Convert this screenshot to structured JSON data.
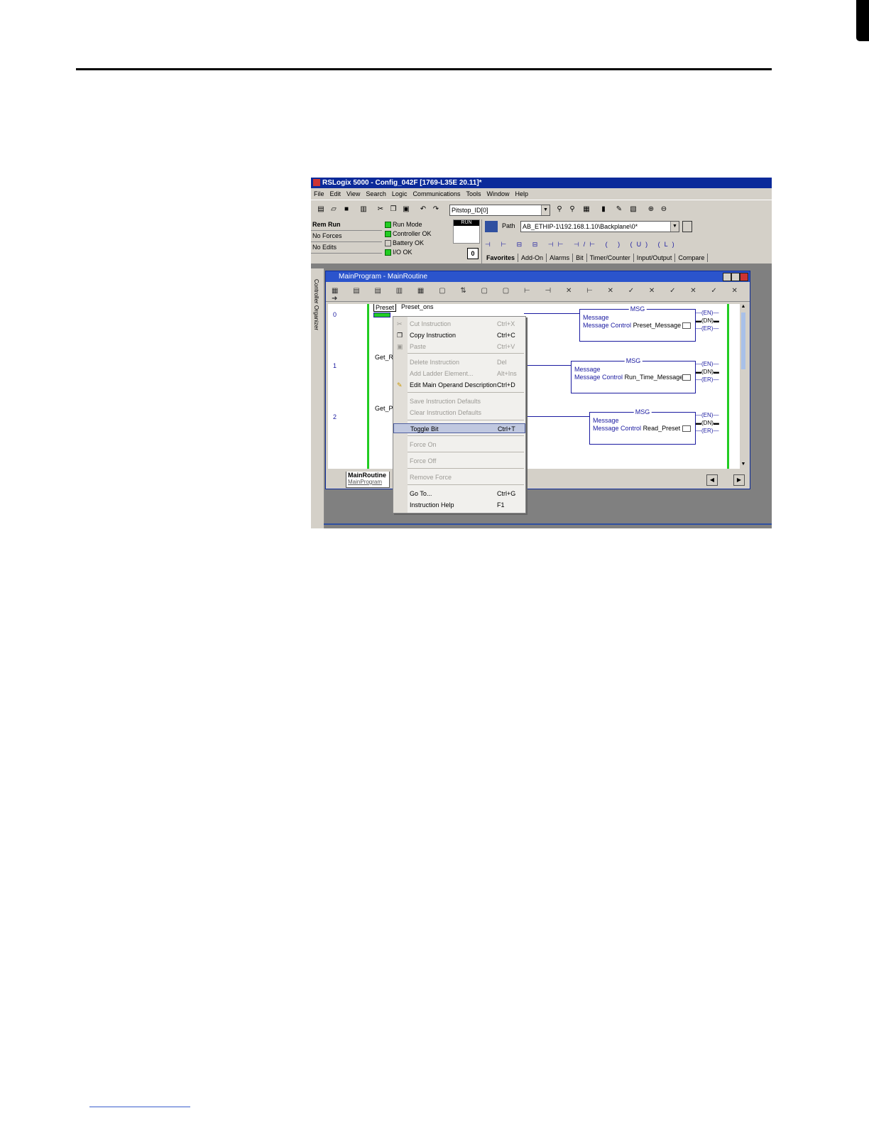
{
  "window_title": "RSLogix 5000 - Config_042F [1769-L35E 20.11]*",
  "menu": [
    "File",
    "Edit",
    "View",
    "Search",
    "Logic",
    "Communications",
    "Tools",
    "Window",
    "Help"
  ],
  "toolbar": {
    "tag_combo": "Pitstop_ID[0]"
  },
  "status": {
    "mode": "Rem Run",
    "forces": "No Forces",
    "edits": "No Edits",
    "indicators": [
      {
        "label": "Run Mode",
        "on": true
      },
      {
        "label": "Controller OK",
        "on": true
      },
      {
        "label": "Battery OK",
        "on": false
      },
      {
        "label": "I/O OK",
        "on": true
      }
    ],
    "keyswitch": "RUN",
    "counter": "0"
  },
  "path": {
    "label": "Path",
    "value": "AB_ETHIP-1\\192.168.1.10\\Backplane\\0*"
  },
  "instr_tabs": [
    "Favorites",
    "Add-On",
    "Alarms",
    "Bit",
    "Timer/Counter",
    "Input/Output",
    "Compare"
  ],
  "side_panel": "Controller Organizer",
  "routine_window": {
    "title": "MainProgram - MainRoutine",
    "tab_name": "MainRoutine",
    "tab_program": "MainProgram"
  },
  "rungs": [
    {
      "num": "0",
      "tag_a": "Preset",
      "tag_b": "Preset_ons",
      "msg_title": "MSG",
      "msg_type": "Message",
      "msg_ctrl_label": "Message Control",
      "msg_ctrl": "Preset_Message"
    },
    {
      "num": "1",
      "tag_a": "Get_R",
      "tag_b": "",
      "msg_title": "MSG",
      "msg_type": "Message",
      "msg_ctrl_label": "Message Control",
      "msg_ctrl": "Run_Time_Message"
    },
    {
      "num": "2",
      "tag_a": "Get_P",
      "tag_b": "",
      "msg_title": "MSG",
      "msg_type": "Message",
      "msg_ctrl_label": "Message Control",
      "msg_ctrl": "Read_Preset"
    }
  ],
  "coils": [
    "EN",
    "DN",
    "ER"
  ],
  "context_menu": [
    {
      "label": "Cut Instruction",
      "shortcut": "Ctrl+X",
      "disabled": true,
      "icon": "scissors-icon"
    },
    {
      "label": "Copy Instruction",
      "shortcut": "Ctrl+C",
      "disabled": false,
      "icon": "copy-icon"
    },
    {
      "label": "Paste",
      "shortcut": "Ctrl+V",
      "disabled": true,
      "icon": "paste-icon"
    },
    {
      "label": "Delete Instruction",
      "shortcut": "Del",
      "disabled": true
    },
    {
      "label": "Add Ladder Element...",
      "shortcut": "Alt+Ins",
      "disabled": true
    },
    {
      "label": "Edit Main Operand Description",
      "shortcut": "Ctrl+D",
      "disabled": false,
      "icon": "pencil-icon"
    },
    {
      "label": "Save Instruction Defaults",
      "shortcut": "",
      "disabled": true
    },
    {
      "label": "Clear Instruction Defaults",
      "shortcut": "",
      "disabled": true
    },
    {
      "label": "Toggle Bit",
      "shortcut": "Ctrl+T",
      "disabled": false,
      "highlight": true
    },
    {
      "label": "Force On",
      "shortcut": "",
      "disabled": true
    },
    {
      "label": "Force Off",
      "shortcut": "",
      "disabled": true
    },
    {
      "label": "Remove Force",
      "shortcut": "",
      "disabled": true
    },
    {
      "label": "Go To...",
      "shortcut": "Ctrl+G",
      "disabled": false
    },
    {
      "label": "Instruction Help",
      "shortcut": "F1",
      "disabled": false
    }
  ]
}
